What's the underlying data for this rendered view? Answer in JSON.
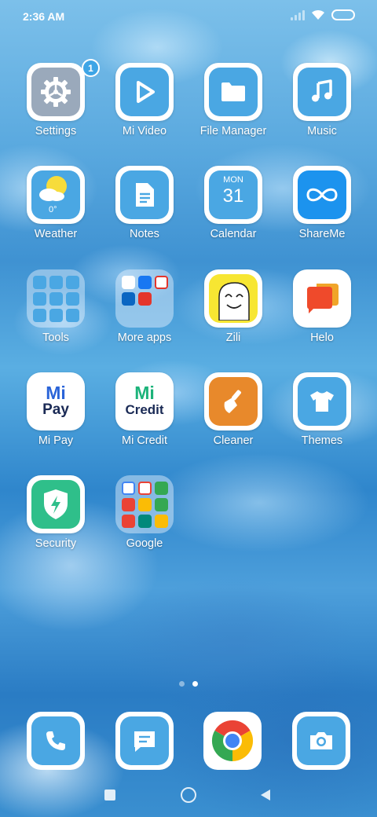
{
  "status_bar": {
    "time": "2:36 AM"
  },
  "badge_count": "1",
  "apps": {
    "settings": "Settings",
    "mi_video": "Mi Video",
    "file_manager": "File Manager",
    "music": "Music",
    "weather": "Weather",
    "weather_temp": "0°",
    "notes": "Notes",
    "calendar": "Calendar",
    "calendar_day": "MON",
    "calendar_date": "31",
    "shareme": "ShareMe",
    "tools": "Tools",
    "more_apps": "More apps",
    "zili": "Zili",
    "helo": "Helo",
    "mi_pay": "Mi Pay",
    "mi_pay_logo_top": "Mi",
    "mi_pay_logo_bottom": "Pay",
    "mi_credit": "Mi Credit",
    "mi_credit_logo_top": "Mi",
    "mi_credit_logo_bottom": "Credit",
    "cleaner": "Cleaner",
    "themes": "Themes",
    "security": "Security",
    "google": "Google"
  },
  "icons": {
    "settings": "gear-icon",
    "mi_video": "play-icon",
    "file_manager": "folder-icon",
    "music": "music-note-icon",
    "weather": "sun-cloud-icon",
    "notes": "document-icon",
    "calendar": "calendar-icon",
    "shareme": "infinity-icon",
    "zili": "face-icon",
    "helo": "chat-bubble-icon",
    "cleaner": "broom-icon",
    "themes": "tshirt-icon",
    "security": "shield-bolt-icon",
    "phone": "phone-icon",
    "messages": "message-icon",
    "chrome": "chrome-icon",
    "camera": "camera-icon"
  },
  "pager": {
    "pages": 2,
    "current": 2
  },
  "colors": {
    "accent_blue": "#4aa7e3",
    "cleaner_orange": "#e8892b",
    "security_green": "#2fbf8a",
    "zili_yellow": "#f7e632"
  }
}
